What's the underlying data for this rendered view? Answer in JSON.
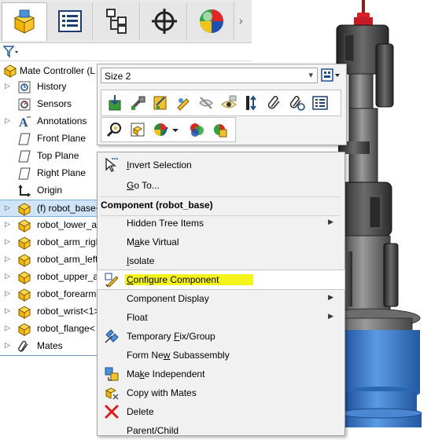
{
  "tree": {
    "root_label": "Mate Controller (L",
    "items": [
      {
        "label": "History",
        "icon": "history-icon",
        "expandable": true
      },
      {
        "label": "Sensors",
        "icon": "sensors-icon",
        "expandable": false
      },
      {
        "label": "Annotations",
        "icon": "annotations-icon",
        "expandable": true
      },
      {
        "label": "Front Plane",
        "icon": "plane-icon",
        "expandable": false
      },
      {
        "label": "Top Plane",
        "icon": "plane-icon",
        "expandable": false
      },
      {
        "label": "Right Plane",
        "icon": "plane-icon",
        "expandable": false
      },
      {
        "label": "Origin",
        "icon": "origin-icon",
        "expandable": false
      },
      {
        "label": "(f) robot_base<",
        "icon": "part-icon",
        "expandable": true,
        "selected": true
      },
      {
        "label": "robot_lower_a",
        "icon": "part-icon",
        "expandable": true
      },
      {
        "label": "robot_arm_righ",
        "icon": "part-icon",
        "expandable": true
      },
      {
        "label": "robot_arm_left",
        "icon": "part-icon",
        "expandable": true
      },
      {
        "label": "robot_upper_a",
        "icon": "part-icon",
        "expandable": true
      },
      {
        "label": "robot_forearm",
        "icon": "part-icon",
        "expandable": true
      },
      {
        "label": "robot_wrist<1>",
        "icon": "part-icon",
        "expandable": true
      },
      {
        "label": "robot_flange<",
        "icon": "part-icon",
        "expandable": true
      },
      {
        "label": "Mates",
        "icon": "mates-icon",
        "expandable": true
      }
    ]
  },
  "toolbar": {
    "config_value": "Size 2"
  },
  "menu": {
    "header": "Component (robot_base)",
    "items": [
      {
        "pre": "",
        "u": "I",
        "post": "nvert Selection",
        "icon": "invert-selection-icon",
        "submenu": false
      },
      {
        "pre": "",
        "u": "G",
        "post": "o To...",
        "icon": "",
        "submenu": false
      },
      {
        "pre": "",
        "u": "",
        "post": "Hidden Tree Items",
        "icon": "",
        "submenu": true
      },
      {
        "pre": "M",
        "u": "a",
        "post": "ke Virtual",
        "icon": "",
        "submenu": false
      },
      {
        "pre": "",
        "u": "I",
        "post": "solate",
        "icon": "",
        "submenu": false
      },
      {
        "pre": "",
        "u": "C",
        "post": "onfigure Component",
        "icon": "configure-component-icon",
        "submenu": false
      },
      {
        "pre": "",
        "u": "",
        "post": "Component Display",
        "icon": "",
        "submenu": true
      },
      {
        "pre": "Float",
        "u": "",
        "post": "",
        "icon": "",
        "submenu": true
      },
      {
        "pre": "Temporary ",
        "u": "F",
        "post": "ix/Group",
        "icon": "fix-group-icon",
        "submenu": false
      },
      {
        "pre": "Form Ne",
        "u": "w",
        "post": " Subassembly",
        "icon": "",
        "submenu": false
      },
      {
        "pre": "Ma",
        "u": "k",
        "post": "e Independent",
        "icon": "make-independent-icon",
        "submenu": false
      },
      {
        "pre": "Copy with Mates",
        "u": "",
        "post": "",
        "icon": "copy-with-mates-icon",
        "submenu": false
      },
      {
        "pre": "",
        "u": "",
        "post": "Delete",
        "icon": "delete-icon",
        "submenu": false
      },
      {
        "pre": "Parent/Child",
        "u": "",
        "post": "",
        "icon": "",
        "submenu": false
      }
    ]
  },
  "colors": {
    "highlight": "#f4f31a",
    "selection": "#cfe5f7",
    "robot_blue": "#3c78c8",
    "robot_red": "#d8202a"
  }
}
